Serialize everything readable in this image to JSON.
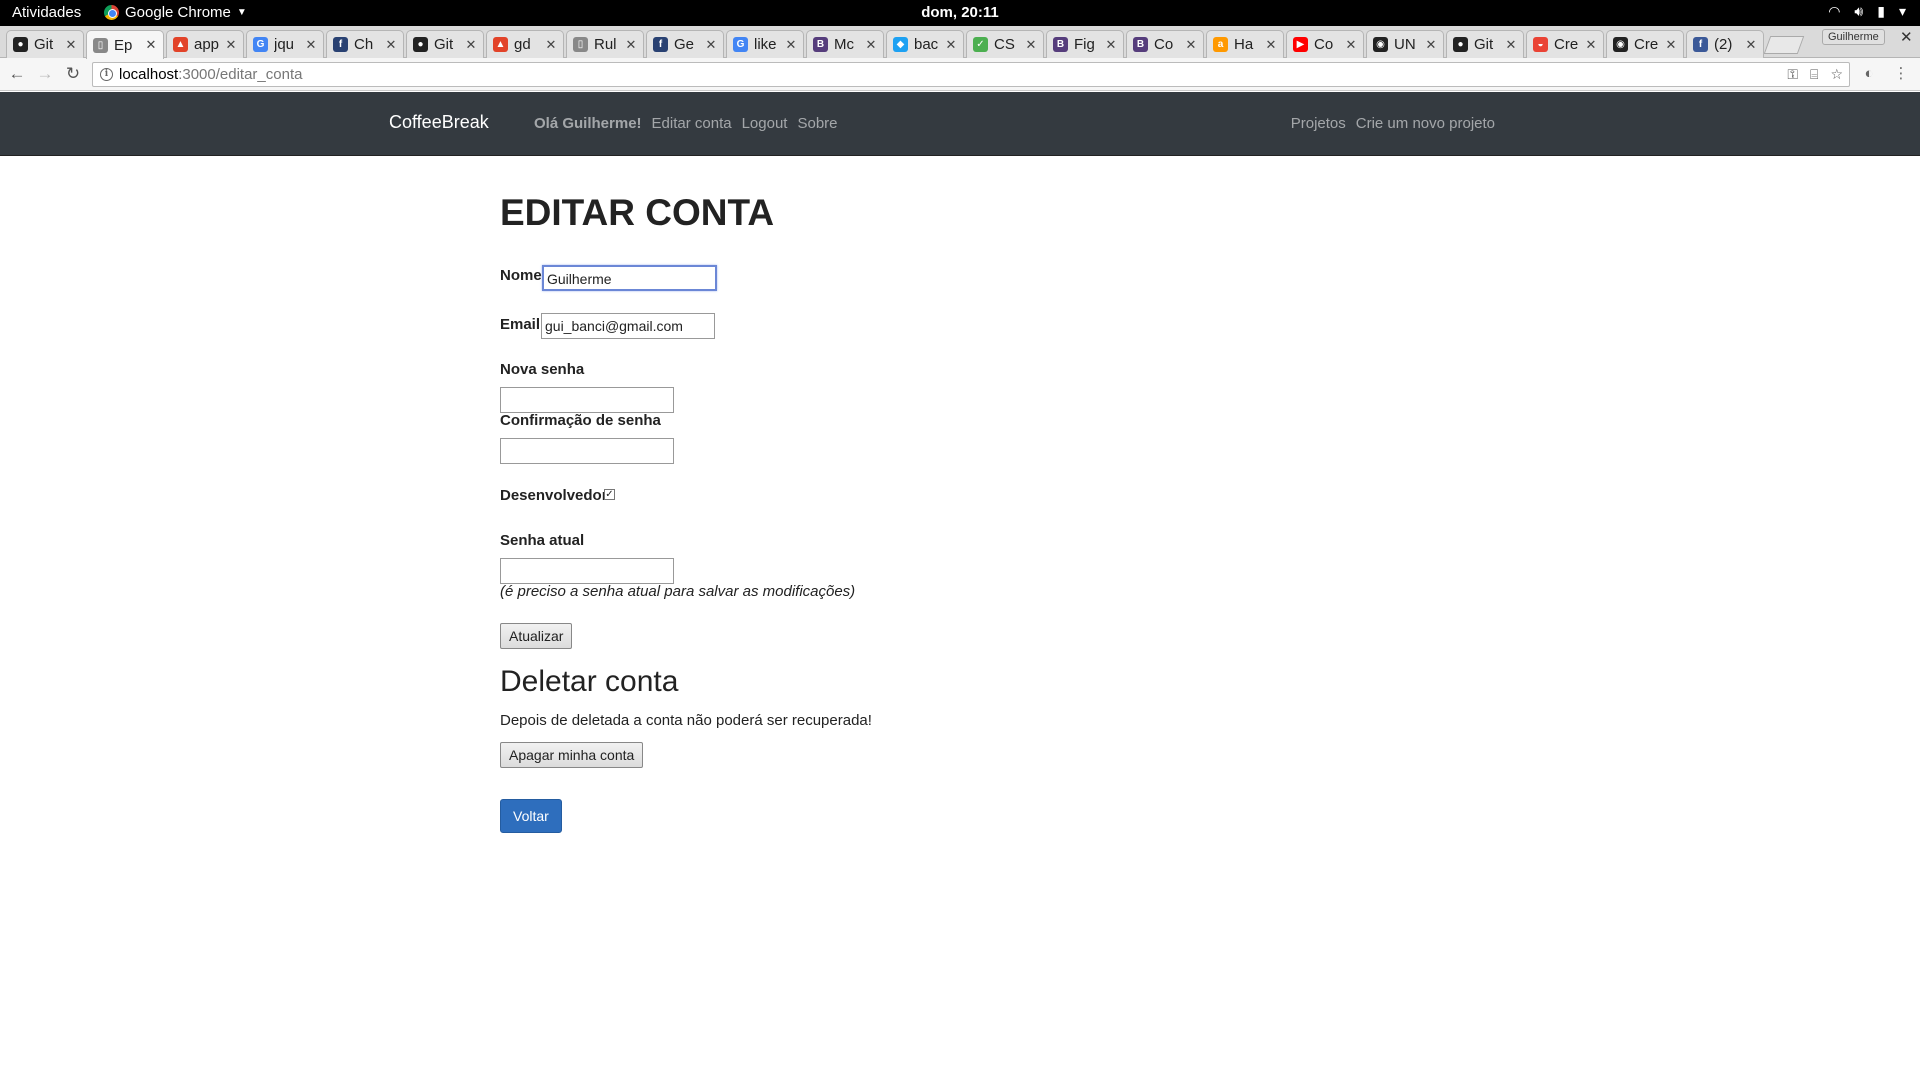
{
  "system_bar": {
    "activities": "Atividades",
    "app_name": "Google Chrome",
    "clock": "dom, 20:11"
  },
  "browser": {
    "tabs": [
      {
        "label": "Git",
        "icon": "github-icon",
        "color": "#222222"
      },
      {
        "label": "Ep",
        "icon": "document-icon",
        "color": "#888888"
      },
      {
        "label": "app",
        "icon": "gitlab-icon",
        "color": "#e24329"
      },
      {
        "label": "jqu",
        "icon": "google-icon",
        "color": "#4285f4"
      },
      {
        "label": "Ch",
        "icon": "fedora-icon",
        "color": "#294172"
      },
      {
        "label": "Git",
        "icon": "github-icon",
        "color": "#222222"
      },
      {
        "label": "gd",
        "icon": "gitlab-icon",
        "color": "#e24329"
      },
      {
        "label": "Rul",
        "icon": "document-icon",
        "color": "#888888"
      },
      {
        "label": "Ge",
        "icon": "fedora-icon",
        "color": "#294172"
      },
      {
        "label": "like",
        "icon": "google-icon",
        "color": "#4285f4"
      },
      {
        "label": "Mc",
        "icon": "bootstrap-icon",
        "color": "#563d7c"
      },
      {
        "label": "bac",
        "icon": "bird-icon",
        "color": "#1da1f2"
      },
      {
        "label": "CS",
        "icon": "css-icon",
        "color": "#4caf50"
      },
      {
        "label": "Fig",
        "icon": "bootstrap-icon",
        "color": "#563d7c"
      },
      {
        "label": "Co",
        "icon": "bootstrap-icon",
        "color": "#563d7c"
      },
      {
        "label": "Ha",
        "icon": "amazon-icon",
        "color": "#ff9900"
      },
      {
        "label": "Co",
        "icon": "youtube-icon",
        "color": "#ff0000"
      },
      {
        "label": "UN",
        "icon": "bulb-icon",
        "color": "#222222"
      },
      {
        "label": "Git",
        "icon": "github-icon",
        "color": "#222222"
      },
      {
        "label": "Cre",
        "icon": "rainbow-icon",
        "color": "#ea4335"
      },
      {
        "label": "Cre",
        "icon": "bulb-icon",
        "color": "#222222"
      },
      {
        "label": "(2)",
        "icon": "facebook-icon",
        "color": "#3b5998"
      }
    ],
    "active_tab_index": 1,
    "profile_name": "Guilherme",
    "url_host": "localhost",
    "url_path": ":3000/editar_conta"
  },
  "site_nav": {
    "brand": "CoffeeBreak",
    "greeting": "Olá Guilherme!",
    "links_left": [
      "Editar conta",
      "Logout",
      "Sobre"
    ],
    "links_right": [
      "Projetos",
      "Crie um novo projeto"
    ]
  },
  "form": {
    "title": "EDITAR CONTA",
    "name_label": "Nome",
    "name_value": "Guilherme",
    "email_label": "Email",
    "email_value": "gui_banci@gmail.com",
    "new_password_label": "Nova senha",
    "confirm_password_label": "Confirmação de senha",
    "developer_label": "Desenvolvedor",
    "developer_checked": true,
    "current_password_label": "Senha atual",
    "current_password_hint": "(é preciso a senha atual para salvar as modificações)",
    "submit_label": "Atualizar"
  },
  "delete_section": {
    "title": "Deletar conta",
    "warning": "Depois de deletada a conta não poderá ser recuperada!",
    "button_label": "Apagar minha conta"
  },
  "back_button": "Voltar"
}
